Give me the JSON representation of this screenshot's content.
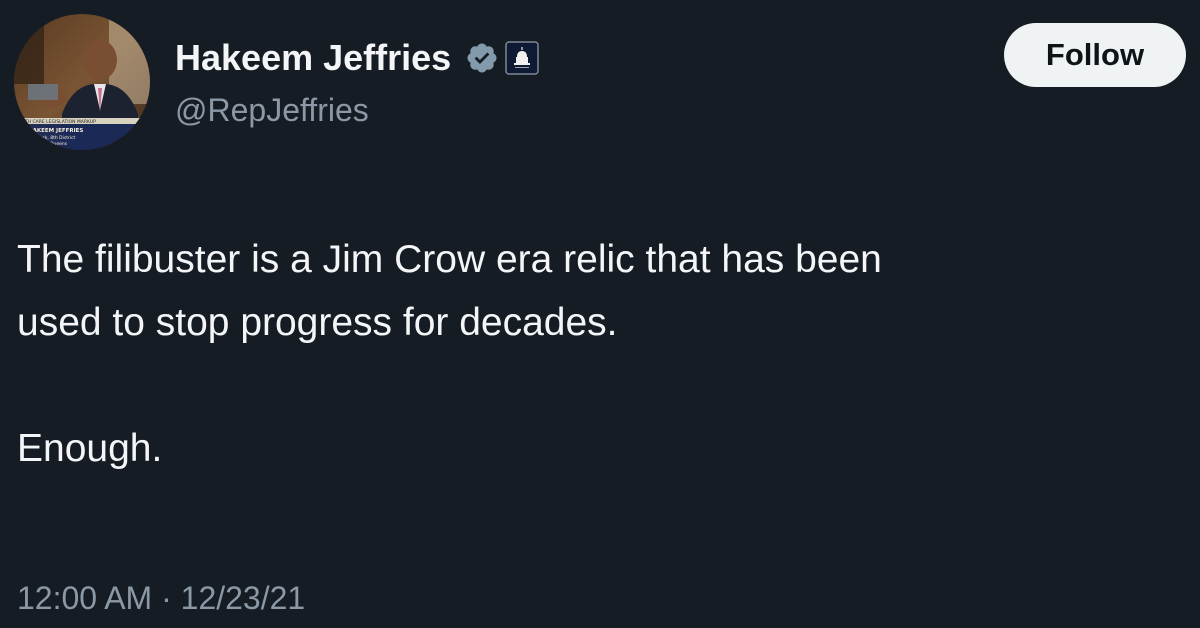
{
  "author": {
    "display_name": "Hakeem Jeffries",
    "handle": "@RepJeffries",
    "verified": true,
    "avatar_icon": "profile-photo",
    "avatar_caption": [
      "ALTH CARE LEGISLATION MARKUP",
      "HAKEEM JEFFRIES",
      "York, 8th District",
      "Queens"
    ]
  },
  "follow_button": {
    "label": "Follow"
  },
  "tweet": {
    "lines": [
      "The filibuster is a Jim Crow era relic that has been",
      "used to stop progress for decades."
    ],
    "closing": "Enough."
  },
  "meta": {
    "timestamp": "12:00 AM · 12/23/21"
  },
  "colors": {
    "background": "#161c24",
    "text": "#f3f5f7",
    "secondary_text": "#8b98a5",
    "verified_badge": "#829aab",
    "follow_bg": "#eff3f4"
  }
}
